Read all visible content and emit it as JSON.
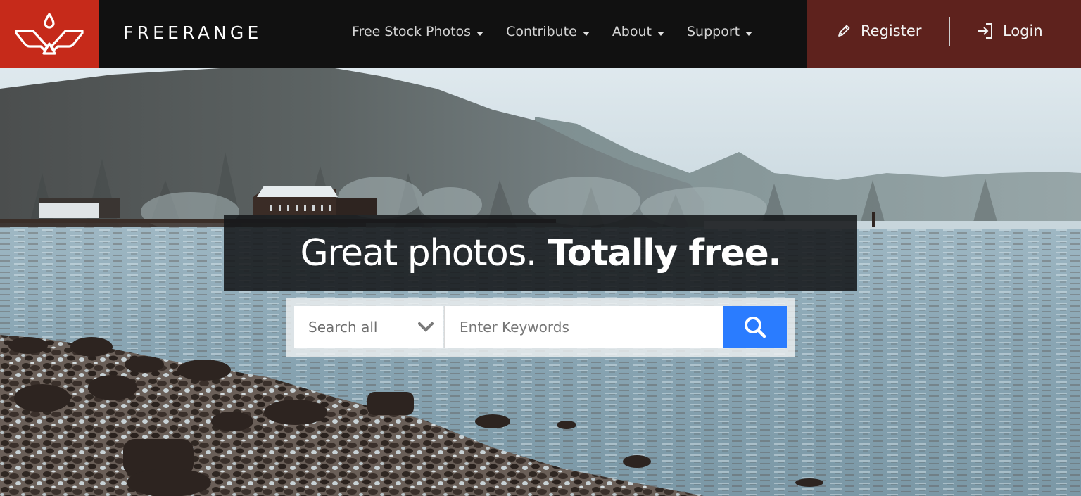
{
  "brand": {
    "name": "FREERANGE",
    "logo_icon": "bird-wings-icon",
    "logo_bg": "#c62a1a"
  },
  "nav": {
    "items": [
      {
        "label": "Free Stock Photos",
        "icon": "caret-down-icon"
      },
      {
        "label": "Contribute",
        "icon": "caret-down-icon"
      },
      {
        "label": "About",
        "icon": "caret-down-icon"
      },
      {
        "label": "Support",
        "icon": "caret-down-icon"
      }
    ]
  },
  "account": {
    "register_label": "Register",
    "register_icon": "pencil-icon",
    "login_label": "Login",
    "login_icon": "sign-in-icon",
    "bg": "#5e221d"
  },
  "hero": {
    "tagline_light": "Great photos.",
    "tagline_bold": "Totally free.",
    "image_description": "Misty forested hillside over a lake with a pier, red-roofed buildings and a rocky shoreline"
  },
  "search": {
    "category_selected": "Search all",
    "category_icon": "chevron-down-icon",
    "keywords_value": "",
    "keywords_placeholder": "Enter Keywords",
    "button_icon": "search-icon",
    "button_color": "#2a7cff"
  }
}
